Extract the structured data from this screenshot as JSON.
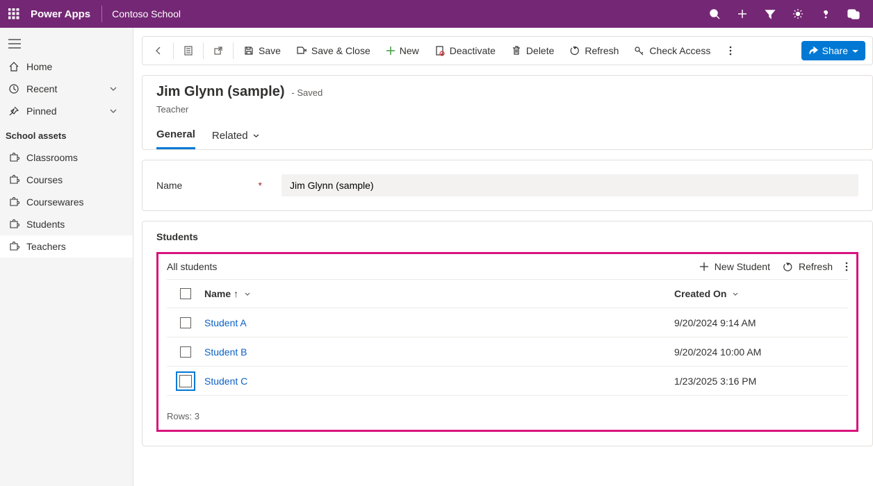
{
  "topbar": {
    "brand": "Power Apps",
    "appname": "Contoso School"
  },
  "sidebar": {
    "items": [
      {
        "label": "Home",
        "icon": "home"
      },
      {
        "label": "Recent",
        "icon": "clock",
        "chevron": true
      },
      {
        "label": "Pinned",
        "icon": "pin",
        "chevron": true
      }
    ],
    "section_label": "School assets",
    "assets": [
      {
        "label": "Classrooms"
      },
      {
        "label": "Courses"
      },
      {
        "label": "Coursewares"
      },
      {
        "label": "Students"
      },
      {
        "label": "Teachers",
        "active": true
      }
    ]
  },
  "commands": {
    "save": "Save",
    "save_close": "Save & Close",
    "new": "New",
    "deactivate": "Deactivate",
    "delete": "Delete",
    "refresh": "Refresh",
    "check_access": "Check Access",
    "share": "Share"
  },
  "record": {
    "title": "Jim Glynn (sample)",
    "saved": "- Saved",
    "entity": "Teacher",
    "tab_general": "General",
    "tab_related": "Related"
  },
  "form": {
    "name_label": "Name",
    "name_value": "Jim Glynn (sample)"
  },
  "subgrid": {
    "title": "Students",
    "view_name": "All students",
    "new_btn": "New Student",
    "refresh_btn": "Refresh",
    "col_name": "Name",
    "col_created": "Created On",
    "rows": [
      {
        "name": "Student A",
        "created": "9/20/2024 9:14 AM"
      },
      {
        "name": "Student B",
        "created": "9/20/2024 10:00 AM"
      },
      {
        "name": "Student C",
        "created": "1/23/2025 3:16 PM",
        "focus": true
      }
    ],
    "rows_label": "Rows: 3"
  },
  "chart_data": {
    "type": "table",
    "title": "All students",
    "columns": [
      "Name",
      "Created On"
    ],
    "rows": [
      [
        "Student A",
        "9/20/2024 9:14 AM"
      ],
      [
        "Student B",
        "9/20/2024 10:00 AM"
      ],
      [
        "Student C",
        "1/23/2025 3:16 PM"
      ]
    ]
  }
}
